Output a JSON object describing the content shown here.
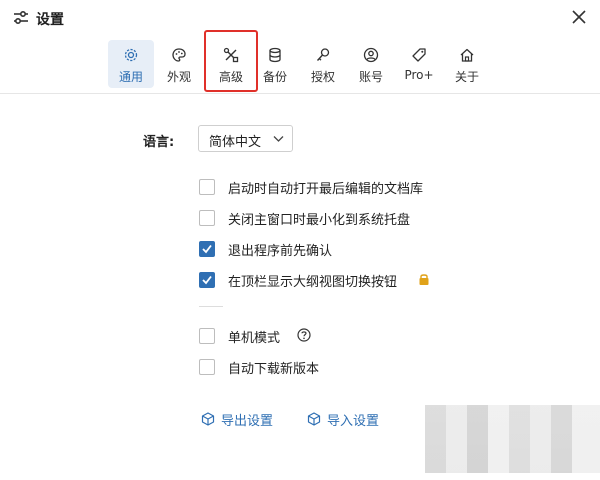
{
  "window": {
    "title": "设置",
    "title_icon": "sliders-icon",
    "close_icon": "close-icon"
  },
  "tabs": [
    {
      "label": "通用",
      "icon": "gear-icon",
      "active": true
    },
    {
      "label": "外观",
      "icon": "palette-icon",
      "active": false
    },
    {
      "label": "高级",
      "icon": "tools-icon",
      "active": false,
      "highlighted": true
    },
    {
      "label": "备份",
      "icon": "database-icon",
      "active": false
    },
    {
      "label": "授权",
      "icon": "key-icon",
      "active": false
    },
    {
      "label": "账号",
      "icon": "user-icon",
      "active": false
    },
    {
      "label": "Pro+",
      "icon": "tag-icon",
      "active": false
    },
    {
      "label": "关于",
      "icon": "home-icon",
      "active": false
    }
  ],
  "colors": {
    "accent": "#2f6fb3",
    "active_tab_bg": "#e7eef7",
    "highlight_border": "#e0302a",
    "lock_icon": "#e0a21a"
  },
  "language": {
    "label": "语言:",
    "selected": "简体中文",
    "icon": "chevron-down-icon"
  },
  "options": [
    {
      "label": "启动时自动打开最后编辑的文档库",
      "checked": false
    },
    {
      "label": "关闭主窗口时最小化到系统托盘",
      "checked": false
    },
    {
      "label": "退出程序前先确认",
      "checked": true
    },
    {
      "label": "在顶栏显示大纲视图切换按钮",
      "checked": true,
      "extra_icon": "lock-icon"
    }
  ],
  "options2": [
    {
      "label": "单机模式",
      "checked": false,
      "extra_icon": "help-icon"
    },
    {
      "label": "自动下载新版本",
      "checked": false
    }
  ],
  "actions": [
    {
      "label": "导出设置",
      "icon": "export-box-icon"
    },
    {
      "label": "导入设置",
      "icon": "import-box-icon"
    }
  ]
}
